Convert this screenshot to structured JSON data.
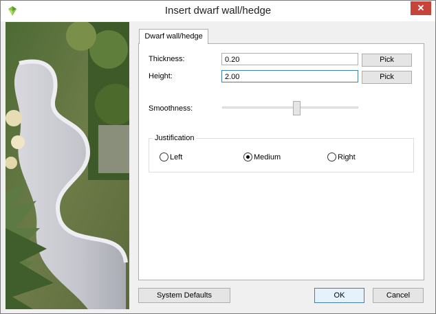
{
  "window": {
    "title": "Insert dwarf wall/hedge",
    "close_glyph": "✕"
  },
  "tabs": [
    {
      "label": "Dwarf wall/hedge",
      "selected": true
    }
  ],
  "form": {
    "thickness": {
      "label": "Thickness:",
      "value": "0.20",
      "button": "Pick"
    },
    "height": {
      "label": "Height:",
      "value": "2.00",
      "button": "Pick"
    },
    "smoothness": {
      "label": "Smoothness:",
      "level": 0.55
    }
  },
  "justification": {
    "title": "Justification",
    "options": [
      {
        "label": "Left",
        "checked": false
      },
      {
        "label": "Medium",
        "checked": true
      },
      {
        "label": "Right",
        "checked": false
      }
    ]
  },
  "footer": {
    "system_defaults": "System Defaults",
    "ok": "OK",
    "cancel": "Cancel"
  },
  "colors": {
    "accent": "#3c7fb1",
    "close": "#c7443a"
  }
}
